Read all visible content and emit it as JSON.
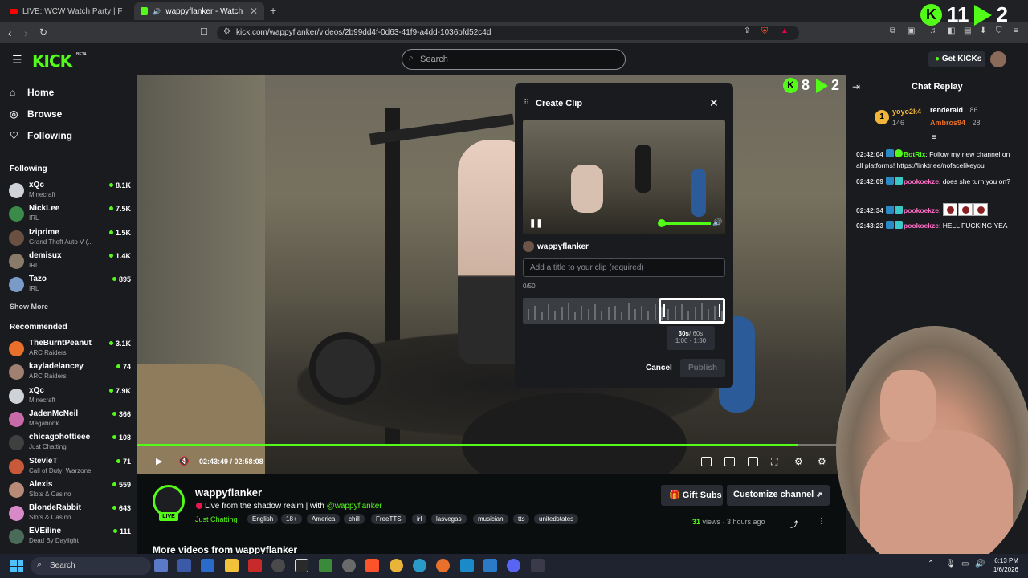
{
  "browser": {
    "tabs": [
      {
        "label": "LIVE: WCW Watch Party | Full PPVs, C",
        "active": false
      },
      {
        "label": "wappyflanker - Watch the VO",
        "active": true
      }
    ],
    "url": "kick.com/wappyflanker/videos/2b99dd4f-0d63-41f9-a4dd-1036bfd52c4d",
    "overlay_counts": {
      "kick": "11",
      "play": "2"
    }
  },
  "header": {
    "logo": "KICK",
    "logo_badge": "BETA",
    "search_placeholder": "Search",
    "get_kicks": "Get KICKs"
  },
  "sidebar": {
    "nav": [
      {
        "label": "Home",
        "icon": "home-icon"
      },
      {
        "label": "Browse",
        "icon": "browse-icon"
      },
      {
        "label": "Following",
        "icon": "heart-icon"
      }
    ],
    "following_title": "Following",
    "following": [
      {
        "name": "xQc",
        "category": "Minecraft",
        "viewers": "8.1K",
        "color": "#cfd3d8"
      },
      {
        "name": "NickLee",
        "category": "IRL",
        "viewers": "7.5K",
        "color": "#3a8a4a"
      },
      {
        "name": "Iziprime",
        "category": "Grand Theft Auto V (...",
        "viewers": "1.5K",
        "color": "#6a5040"
      },
      {
        "name": "demisux",
        "category": "IRL",
        "viewers": "1.4K",
        "color": "#8a7a6a"
      },
      {
        "name": "Tazo",
        "category": "IRL",
        "viewers": "895",
        "color": "#7a9ac8"
      }
    ],
    "show_more": "Show More",
    "recommended_title": "Recommended",
    "recommended": [
      {
        "name": "TheBurntPeanut",
        "category": "ARC Raiders",
        "viewers": "3.1K",
        "color": "#e8702a"
      },
      {
        "name": "kayladelancey",
        "category": "ARC Raiders",
        "viewers": "74",
        "color": "#a08070"
      },
      {
        "name": "xQc",
        "category": "Minecraft",
        "viewers": "7.9K",
        "color": "#cfd3d8"
      },
      {
        "name": "JadenMcNeil",
        "category": "Megabonk",
        "viewers": "366",
        "color": "#c86aa8"
      },
      {
        "name": "chicagohottieee",
        "category": "Just Chatting",
        "viewers": "108",
        "color": "#404040"
      },
      {
        "name": "StevieT",
        "category": "Call of Duty: Warzone",
        "viewers": "71",
        "color": "#c85a3a"
      },
      {
        "name": "Alexis",
        "category": "Slots & Casino",
        "viewers": "559",
        "color": "#b88a78"
      },
      {
        "name": "BlondeRabbit",
        "category": "Slots & Casino",
        "viewers": "643",
        "color": "#d88ac8"
      },
      {
        "name": "EVEiline",
        "category": "Dead By Daylight",
        "viewers": "111",
        "color": "#4a6a5a"
      }
    ]
  },
  "player": {
    "time_current": "02:43:49",
    "time_total": "02:58:08",
    "progress": 0.9317,
    "overlay_counts": {
      "kick": "8",
      "play": "2"
    }
  },
  "clip_modal": {
    "title": "Create Clip",
    "channel": "wappyflanker",
    "input_placeholder": "Add a title to your clip (required)",
    "counter": "0/50",
    "duration": "30s",
    "max_duration": "/ 60s",
    "range": "1:00 - 1:30",
    "cancel": "Cancel",
    "publish": "Publish"
  },
  "channel": {
    "name": "wappyflanker",
    "live_badge": "LIVE",
    "stream_title": "Live from the shadow realm | with ",
    "mention": "@wappyflanker",
    "category": "Just Chatting",
    "tags": [
      "English",
      "18+",
      "America",
      "chill",
      "FreeTTS",
      "irl",
      "lasvegas",
      "musician",
      "tts",
      "unitedstates"
    ],
    "gift_subs": "Gift Subs",
    "customize": "Customize channel",
    "views_count": "31",
    "views_label": " views",
    "ago": "3 hours ago",
    "more_videos": "More videos from wappyflanker"
  },
  "chat": {
    "title": "Chat Replay",
    "gifters": [
      {
        "name": "yoyo2k4",
        "count": "146",
        "color": "#f2b53a"
      },
      {
        "name": "renderaid",
        "count": "86",
        "color": "#ffffff"
      },
      {
        "name": "Ambros94",
        "count": "28",
        "color": "#e8702a"
      }
    ],
    "messages": [
      {
        "ts": "02:42:04",
        "user": "BotRix",
        "user_color": "#53fc18",
        "text": ": Follow my new channel on all platforms! ",
        "link": "https://linktr.ee/nofacelikeyou"
      },
      {
        "ts": "02:42:09",
        "user": "pookoekze",
        "user_color": "#ff6ec7",
        "text": ": does she turn you on?",
        "link": ""
      },
      {
        "ts": "02:42:34",
        "user": "pookoekze",
        "user_color": "#ff6ec7",
        "text": ":",
        "link": ""
      },
      {
        "ts": "02:43:23",
        "user": "pookoekze",
        "user_color": "#ff6ec7",
        "text": ": HELL FUCKING YEA",
        "link": ""
      }
    ]
  },
  "taskbar": {
    "search": "Search",
    "time": "6:13 PM",
    "date": "1/6/2026"
  }
}
